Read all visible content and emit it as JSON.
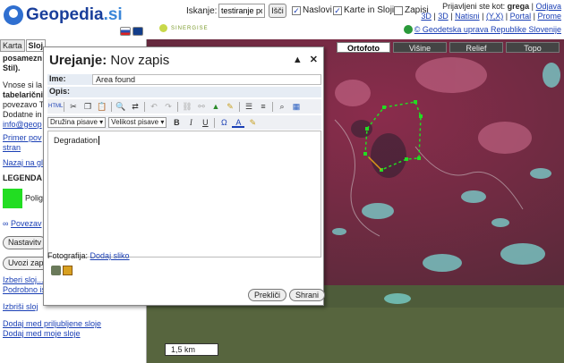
{
  "header": {
    "logo_text": "Geopedia",
    "logo_suffix": ".si",
    "search_label": "Iskanje:",
    "search_value": "testiranje poligoni",
    "search_button": "Išči",
    "checkboxes": [
      {
        "label": "Naslovi",
        "checked": true
      },
      {
        "label": "Karte in Sloji",
        "checked": true
      },
      {
        "label": "Zapisi",
        "checked": false
      }
    ],
    "user_prefix": "Prijavljeni ste kot:",
    "user_name": "grega",
    "logout": "Odjava",
    "links": [
      "3D",
      "3D",
      "Natisni",
      "(Y,X)",
      "Portal",
      "Prome"
    ],
    "sinergise": "SINERGISE",
    "copyright": "© Geodetska uprava Republike Slovenije"
  },
  "left_panel": {
    "tabs": [
      "Karta",
      "Sloj"
    ],
    "lines": [
      "posamezn",
      "Stil).",
      "Vnose si la",
      "tabelarični",
      "povezavo T",
      "Dodatne in",
      "info@geop",
      "Primer pov",
      "stran",
      "Nazaj na gl",
      "LEGENDA"
    ],
    "legend_label": "Polig",
    "povezava": "Povezav",
    "btn_nastavitve": "Nastavitv",
    "btn_uvozi": "Uvozi zap",
    "links": [
      "Izberi sloj...",
      "Podrobno iskanje...",
      "Izbriši sloj",
      "Dodaj med priljubljene sloje",
      "Dodaj med moje sloje"
    ]
  },
  "map": {
    "tabs": [
      "Ortofoto",
      "Višine",
      "Relief",
      "Topo"
    ],
    "active_tab": "Ortofoto",
    "scale": "1,5 km"
  },
  "dialog": {
    "title_bold": "Urejanje:",
    "title_rest": "Nov zapis",
    "ime_label": "Ime:",
    "ime_value": "Area found",
    "opis_label": "Opis:",
    "font_family_select": "Družina pisave",
    "font_size_select": "Velikost pisave",
    "editor_text": "Degradation",
    "photo_label": "Fotografija:",
    "photo_link": "Dodaj sliko",
    "cancel_button": "Prekliči",
    "save_button": "Shrani"
  }
}
